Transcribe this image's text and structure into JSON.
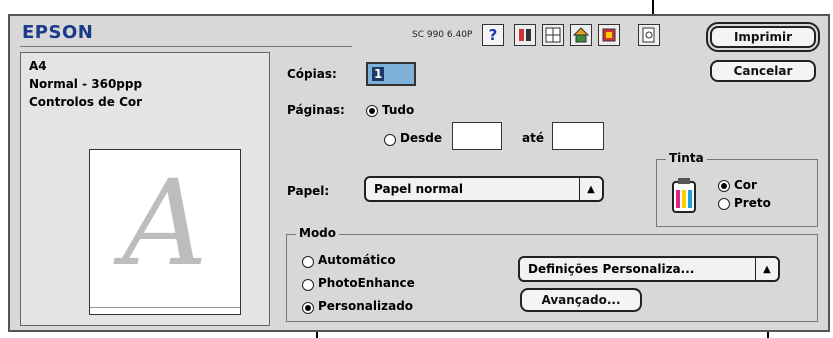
{
  "brand": "EPSON",
  "model": "SC 990 6.40P",
  "summary": {
    "paper_size": "A4",
    "quality": "Normal - 360ppp",
    "color_controls": "Controlos de Cor",
    "preview_letter": "A"
  },
  "buttons": {
    "print": "Imprimir",
    "cancel": "Cancelar",
    "custom_settings": "Definições Personaliza...",
    "advanced": "Avançado..."
  },
  "copies": {
    "label": "Cópias:",
    "value": "1"
  },
  "pages": {
    "label": "Páginas:",
    "all": "Tudo",
    "from": "Desde",
    "to": "até",
    "from_value": "",
    "to_value": ""
  },
  "paper": {
    "label": "Papel:",
    "value": "Papel normal"
  },
  "ink": {
    "label": "Tinta",
    "color": "Cor",
    "black": "Preto",
    "selected": "Cor"
  },
  "mode": {
    "label": "Modo",
    "automatic": "Automático",
    "photoenhance": "PhotoEnhance",
    "custom": "Personalizado",
    "selected": "Personalizado"
  },
  "icons": [
    "help-icon",
    "print-head-icon",
    "grid-icon",
    "home-icon",
    "cartridge-icon",
    "preview-icon",
    "ink-cartridge-icon"
  ]
}
